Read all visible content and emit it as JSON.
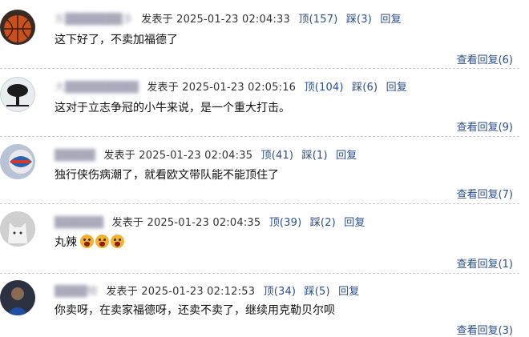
{
  "comments": [
    {
      "username": "东███████多",
      "posted_label": "发表于",
      "datetime": "2025-01-23 02:04:33",
      "like": "顶(157)",
      "dislike": "踩(3)",
      "reply": "回复",
      "content": "这下好了，不卖加福德了",
      "view_replies": "查看回复(6)",
      "avatar_icon": "basketball-avatar-icon"
    },
    {
      "username": "大█████████",
      "posted_label": "发表于",
      "datetime": "2025-01-23 02:05:16",
      "like": "顶(104)",
      "dislike": "踩(6)",
      "reply": "回复",
      "content": "这对于立志争冠的小牛来说，是一个重大打击。",
      "view_replies": "查看回复(9)",
      "avatar_icon": "tree-avatar-icon"
    },
    {
      "username": "█████",
      "posted_label": "发表于",
      "datetime": "2025-01-23 02:04:35",
      "like": "顶(41)",
      "dislike": "踩(1)",
      "reply": "回复",
      "content": "独行侠伤病潮了，就看欧文带队能不能顶住了",
      "view_replies": "查看回复(7)",
      "avatar_icon": "ball-avatar-icon"
    },
    {
      "username": "██████",
      "posted_label": "发表于",
      "datetime": "2025-01-23 02:04:35",
      "like": "顶(39)",
      "dislike": "踩(2)",
      "reply": "回复",
      "content": "丸辣",
      "emoji_count": 3,
      "view_replies": "查看回复(1)",
      "avatar_icon": "cat-avatar-icon"
    },
    {
      "username": "████鳍",
      "posted_label": "发表于",
      "datetime": "2025-01-23 02:12:53",
      "like": "顶(34)",
      "dislike": "踩(5)",
      "reply": "回复",
      "content": "你卖呀，在卖家福德呀，还卖不卖了，继续用克勒贝尔呗",
      "view_replies": "查看回复(3)",
      "avatar_icon": "player-avatar-icon"
    }
  ]
}
